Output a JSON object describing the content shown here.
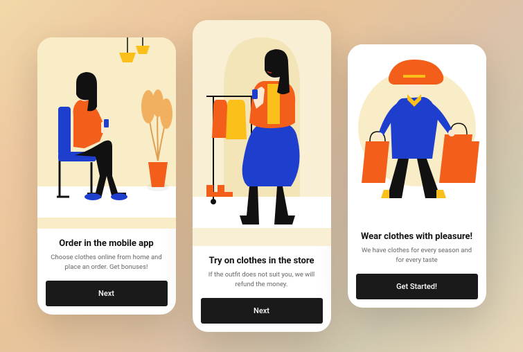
{
  "colors": {
    "accent_orange": "#f45e1b",
    "accent_blue": "#1e3fce",
    "accent_yellow": "#fbbf1a",
    "dark": "#1a1a1a",
    "cream": "#f9edc8"
  },
  "screens": [
    {
      "title": "Order in the mobile app",
      "description": "Choose clothes online from home and place an order. Get bonuses!",
      "cta_label": "Next"
    },
    {
      "title": "Try on clothes in the store",
      "description": "If the outfit does not suit you, we will refund the money.",
      "cta_label": "Next"
    },
    {
      "title": "Wear clothes with pleasure!",
      "description": "We have clothes for every season and for every taste",
      "cta_label": "Get Started!"
    }
  ]
}
